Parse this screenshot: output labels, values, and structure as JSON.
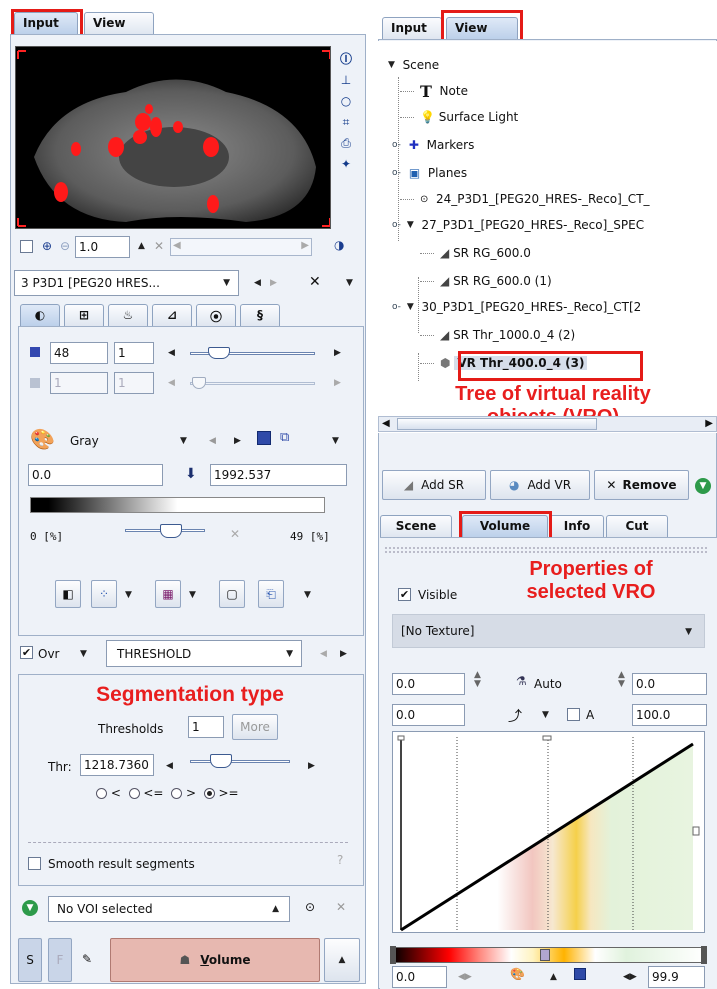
{
  "left": {
    "tabs": [
      "Input",
      "View"
    ],
    "image_controls": {
      "zoom_value": "1.0",
      "side_icons": [
        "info-icon",
        "align-icon",
        "circle-icon",
        "fit-icon",
        "print-icon",
        "crosshair-icon"
      ]
    },
    "series_select": "3 P3D1 [PEG20 HRES...",
    "sub_tabs": [
      "contrast-tab-icon",
      "layout-tab-icon",
      "fusion-tab-icon",
      "chart-tab-icon",
      "movie-tab-icon",
      "meta-tab-icon"
    ],
    "slice": {
      "value": "48",
      "step": "1",
      "frame": "1",
      "frame_step": "1"
    },
    "color": {
      "table": "Gray",
      "min": "0.0",
      "max": "1992.537",
      "pct_min": "0 [%]",
      "pct_max": "49 [%]"
    },
    "segmentation": {
      "ovr_label": "Ovr",
      "method": "THRESHOLD",
      "thresholds_label": "Thresholds",
      "thresholds_count": "1",
      "more_label": "More",
      "thr_label": "Thr:",
      "thr_value": "1218.7360",
      "compare_options": [
        "<",
        "<=",
        ">",
        ">="
      ],
      "selected_compare": ">=",
      "smooth_label": "Smooth result segments",
      "help": "?"
    },
    "voi": {
      "selection": "No VOI selected"
    },
    "bottom": {
      "s": "S",
      "f": "F",
      "volume_label": "Volume",
      "volume_hotkey": "V",
      "volume_rest": "olume"
    }
  },
  "right": {
    "tabs": [
      "Input",
      "View"
    ],
    "tree": [
      {
        "label": "Scene",
        "icon": "",
        "level": 0
      },
      {
        "label": "Note",
        "icon": "T",
        "level": 1
      },
      {
        "label": "Surface Light",
        "icon": "bulb",
        "level": 1
      },
      {
        "label": "Markers",
        "icon": "axes",
        "level": 1
      },
      {
        "label": "Planes",
        "icon": "cube",
        "level": 1
      },
      {
        "label": "24_P3D1_[PEG20_HRES-_Reco]_CT_",
        "icon": "dot",
        "level": 1
      },
      {
        "label": "27_P3D1_[PEG20_HRES-_Reco]_SPEC",
        "icon": "",
        "level": 1
      },
      {
        "label": "SR RG_600.0",
        "icon": "surf",
        "level": 2
      },
      {
        "label": "SR RG_600.0 (1)",
        "icon": "surf",
        "level": 2
      },
      {
        "label": "30_P3D1_[PEG20_HRES-_Reco]_CT[2",
        "icon": "",
        "level": 1
      },
      {
        "label": "SR Thr_1000.0_4 (2)",
        "icon": "surf",
        "level": 2
      },
      {
        "label": "VR Thr_400.0_4 (3)",
        "icon": "vol",
        "level": 2
      }
    ],
    "buttons": {
      "add_sr": "Add SR",
      "add_vr": "Add VR",
      "remove": "Remove"
    },
    "prop_tabs": [
      "Scene",
      "Volume",
      "Info",
      "Cut"
    ],
    "volume": {
      "visible_label": "Visible",
      "texture": "[No Texture]",
      "lo": "0.0",
      "auto_label": "Auto",
      "hi": "0.0",
      "lo2": "0.0",
      "a_label": "A",
      "hi2": "100.0",
      "bottom_lo": "0.0",
      "bottom_hi": "99.9"
    }
  },
  "annotations": {
    "segmentation_type": "Segmentation type",
    "tree_vro_line1": "Tree of virtual reality",
    "tree_vro_line2": "objects (VRO)",
    "props_line1": "Properties of",
    "props_line2": "selected VRO"
  },
  "colors": {
    "accent_red": "#e41b17",
    "panel_bg": "#eef2f8",
    "border": "#8ea3c0"
  }
}
